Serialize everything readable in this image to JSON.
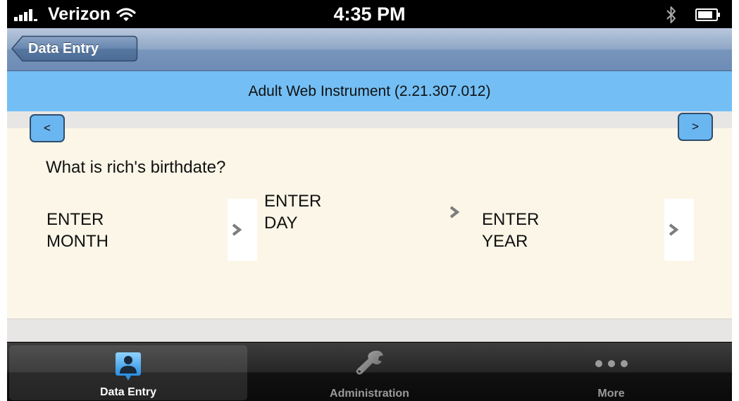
{
  "status_bar": {
    "carrier": "Verizon",
    "time": "4:35 PM"
  },
  "nav": {
    "back_label": "Data Entry"
  },
  "instrument": {
    "title": "Adult Web Instrument (2.21.307.012)"
  },
  "pager": {
    "prev_label": "<",
    "next_label": ">"
  },
  "question": {
    "text": "What is rich's birthdate?"
  },
  "pickers": {
    "month": {
      "line1": "ENTER",
      "line2": "MONTH"
    },
    "day": {
      "line1": "ENTER",
      "line2": "DAY"
    },
    "year": {
      "line1": "ENTER",
      "line2": "YEAR"
    }
  },
  "tabs": [
    {
      "label": "Data Entry",
      "icon": "person-icon",
      "active": true
    },
    {
      "label": "Administration",
      "icon": "wrench-icon",
      "active": false
    },
    {
      "label": "More",
      "icon": "more-dots-icon",
      "active": false
    }
  ],
  "colors": {
    "title_bar": "#73bff5",
    "content_bg": "#fbf6e7",
    "button_fill": "#6ab6f1",
    "tab_active_label": "#ffffff",
    "tab_inactive_label": "#9a9a9a"
  }
}
